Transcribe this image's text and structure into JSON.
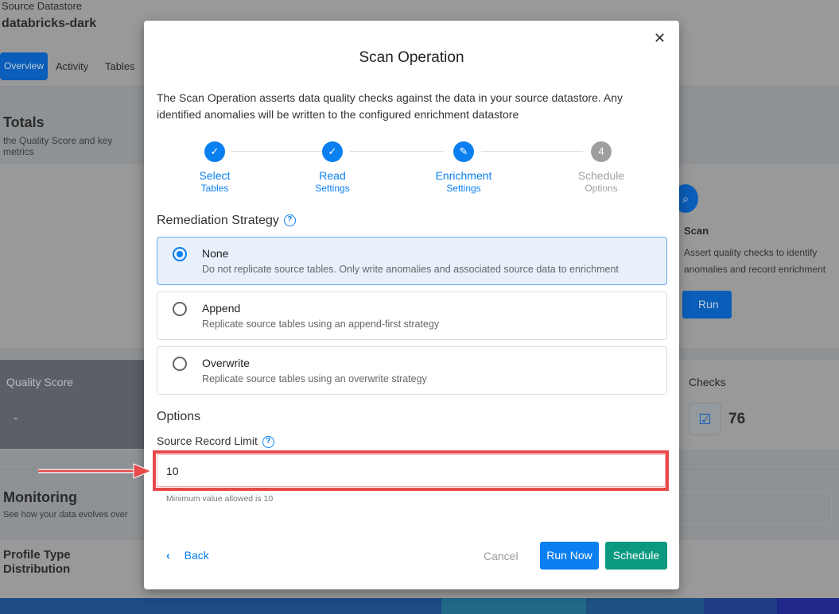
{
  "background": {
    "breadcrumb": "Source Datastore",
    "datastore_name": "databricks-dark",
    "tabs": [
      {
        "label": "Overview",
        "active": true
      },
      {
        "label": "Activity"
      },
      {
        "label": "Tables"
      }
    ],
    "totals_title": "Totals",
    "totals_subtitle": "the Quality Score and key metrics",
    "scan_card": {
      "title": "Scan",
      "description_1": "Assert quality checks to identify",
      "description_2": "anomalies and record enrichment",
      "run_label": "Run"
    },
    "quality_score_label": "Quality Score",
    "quality_score_value": "-",
    "checks_label": "Checks",
    "checks_value": "76",
    "monitoring_title": "Monitoring",
    "monitoring_subtitle": "See how your data evolves over",
    "distribution_title": "Profile Type Distribution"
  },
  "modal": {
    "title": "Scan Operation",
    "description": "The Scan Operation asserts data quality checks against the data in your source datastore. Any identified anomalies will be written to the configured enrichment datastore",
    "steps": [
      {
        "line1": "Select",
        "line2": "Tables",
        "state": "done",
        "icon": "check-icon"
      },
      {
        "line1": "Read",
        "line2": "Settings",
        "state": "done",
        "icon": "check-icon"
      },
      {
        "line1": "Enrichment",
        "line2": "Settings",
        "state": "active",
        "icon": "pencil-icon"
      },
      {
        "line1": "Schedule",
        "line2": "Options",
        "state": "pending",
        "number": "4"
      }
    ],
    "remediation_label": "Remediation Strategy",
    "options": [
      {
        "title": "None",
        "description": "Do not replicate source tables. Only write anomalies and associated source data to enrichment",
        "selected": true
      },
      {
        "title": "Append",
        "description": "Replicate source tables using an append-first strategy",
        "selected": false
      },
      {
        "title": "Overwrite",
        "description": "Replicate source tables using an overwrite strategy",
        "selected": false
      }
    ],
    "options_heading": "Options",
    "record_limit_label": "Source Record Limit",
    "record_limit_value": "10",
    "record_limit_hint": "Minimum value allowed is 10",
    "back_label": "Back",
    "cancel_label": "Cancel",
    "run_now_label": "Run Now",
    "schedule_label": "Schedule"
  },
  "colors": {
    "primary": "#0a7ff0",
    "schedule": "#0b9a80",
    "highlight": "#e84a4a"
  }
}
